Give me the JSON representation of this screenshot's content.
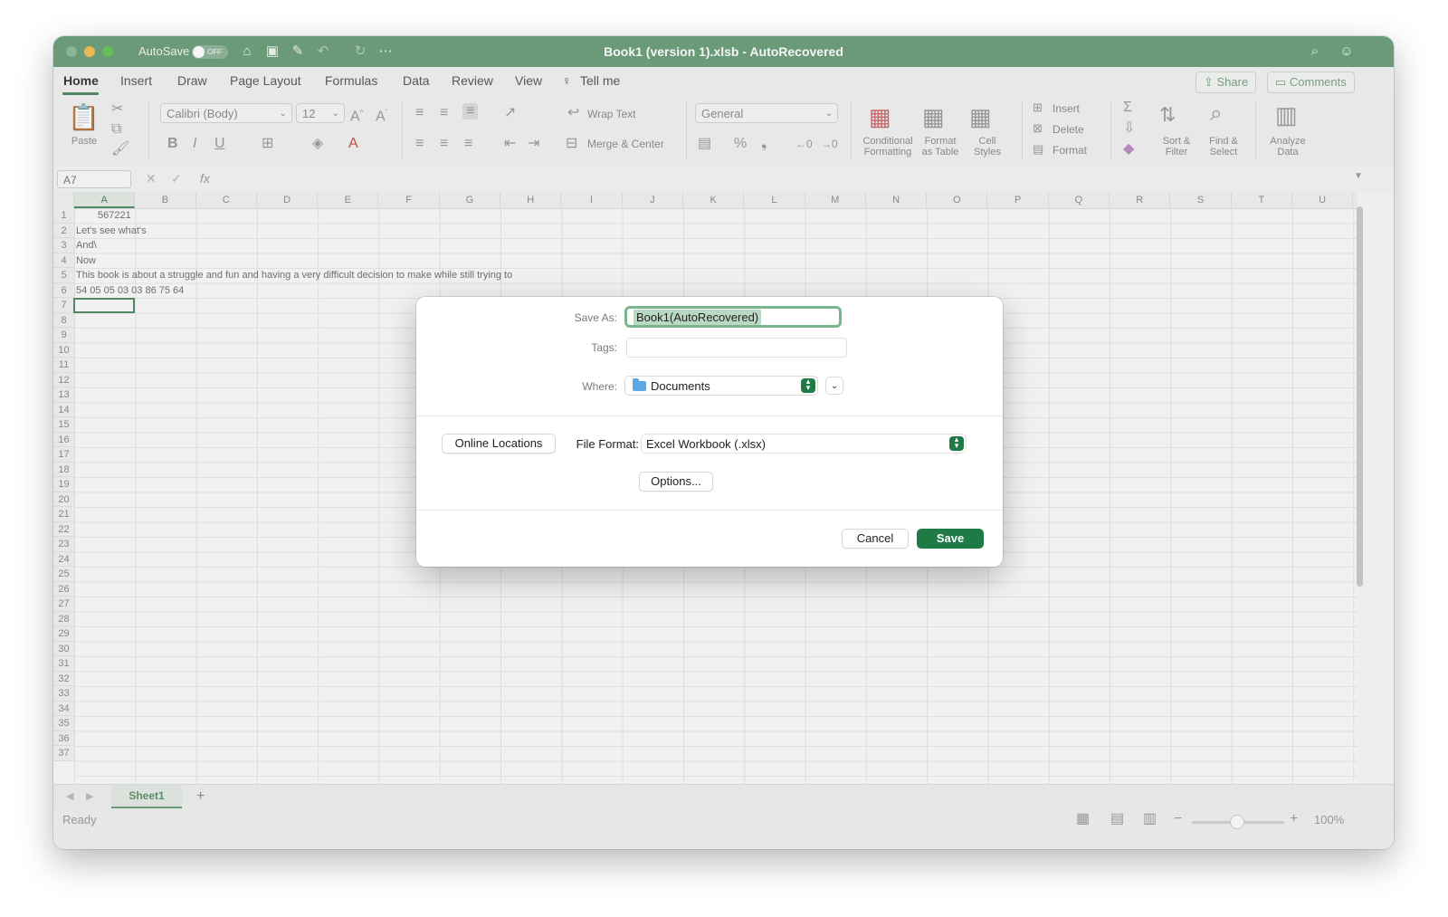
{
  "titlebar": {
    "autosave_label": "AutoSave",
    "autosave_state": "OFF",
    "document_title": "Book1 (version 1).xlsb  -  AutoRecovered"
  },
  "ribbon_tabs": [
    {
      "label": "Home",
      "active": true
    },
    {
      "label": "Insert"
    },
    {
      "label": "Draw"
    },
    {
      "label": "Page Layout"
    },
    {
      "label": "Formulas"
    },
    {
      "label": "Data"
    },
    {
      "label": "Review"
    },
    {
      "label": "View"
    },
    {
      "label": "Tell me"
    }
  ],
  "share_label": "Share",
  "comments_label": "Comments",
  "ribbon": {
    "paste_label": "Paste",
    "font_name": "Calibri (Body)",
    "font_size": "12",
    "wrap_text": "Wrap Text",
    "merge_center": "Merge & Center",
    "number_format": "General",
    "conditional_formatting": "Conditional\nFormatting",
    "format_as_table": "Format\nas Table",
    "cell_styles": "Cell\nStyles",
    "insert": "Insert",
    "delete": "Delete",
    "format": "Format",
    "sort_filter": "Sort &\nFilter",
    "find_select": "Find &\nSelect",
    "analyze_data": "Analyze\nData"
  },
  "formula_bar": {
    "name_box": "A7",
    "fx": "fx"
  },
  "columns": [
    "A",
    "B",
    "C",
    "D",
    "E",
    "F",
    "G",
    "H",
    "I",
    "J",
    "K",
    "L",
    "M",
    "N",
    "O",
    "P",
    "Q",
    "R",
    "S",
    "T",
    "U"
  ],
  "rows": [
    "1",
    "2",
    "3",
    "4",
    "5",
    "6",
    "7",
    "8",
    "9",
    "10",
    "11",
    "12",
    "13",
    "14",
    "15",
    "16",
    "17",
    "18",
    "19",
    "20",
    "21",
    "22",
    "23",
    "24",
    "25",
    "26",
    "27",
    "28",
    "29",
    "30",
    "31",
    "32",
    "33",
    "34",
    "35",
    "36",
    "37"
  ],
  "cells": {
    "a1": "567221",
    "a2": "Let's see what's",
    "a3": "And\\",
    "a4": "Now",
    "a5": "This book is about a struggle and fun and having a very difficult decision to make while still trying to",
    "a6": "54 05 05 03 03 86 75 64"
  },
  "sheet_tab": "Sheet1",
  "add_sheet": "+",
  "status": {
    "text": "Ready",
    "zoom": "100%",
    "zoom_minus": "−",
    "zoom_plus": "+"
  },
  "dialog": {
    "save_as_label": "Save As:",
    "save_as_value": "Book1(AutoRecovered)",
    "tags_label": "Tags:",
    "where_label": "Where:",
    "where_value": "Documents",
    "online_locations": "Online Locations",
    "file_format_label": "File Format:",
    "file_format_value": "Excel Workbook (.xlsx)",
    "options": "Options...",
    "cancel": "Cancel",
    "save": "Save"
  },
  "colors": {
    "accent": "#6a9e79",
    "primary_button": "#1f7a46"
  }
}
